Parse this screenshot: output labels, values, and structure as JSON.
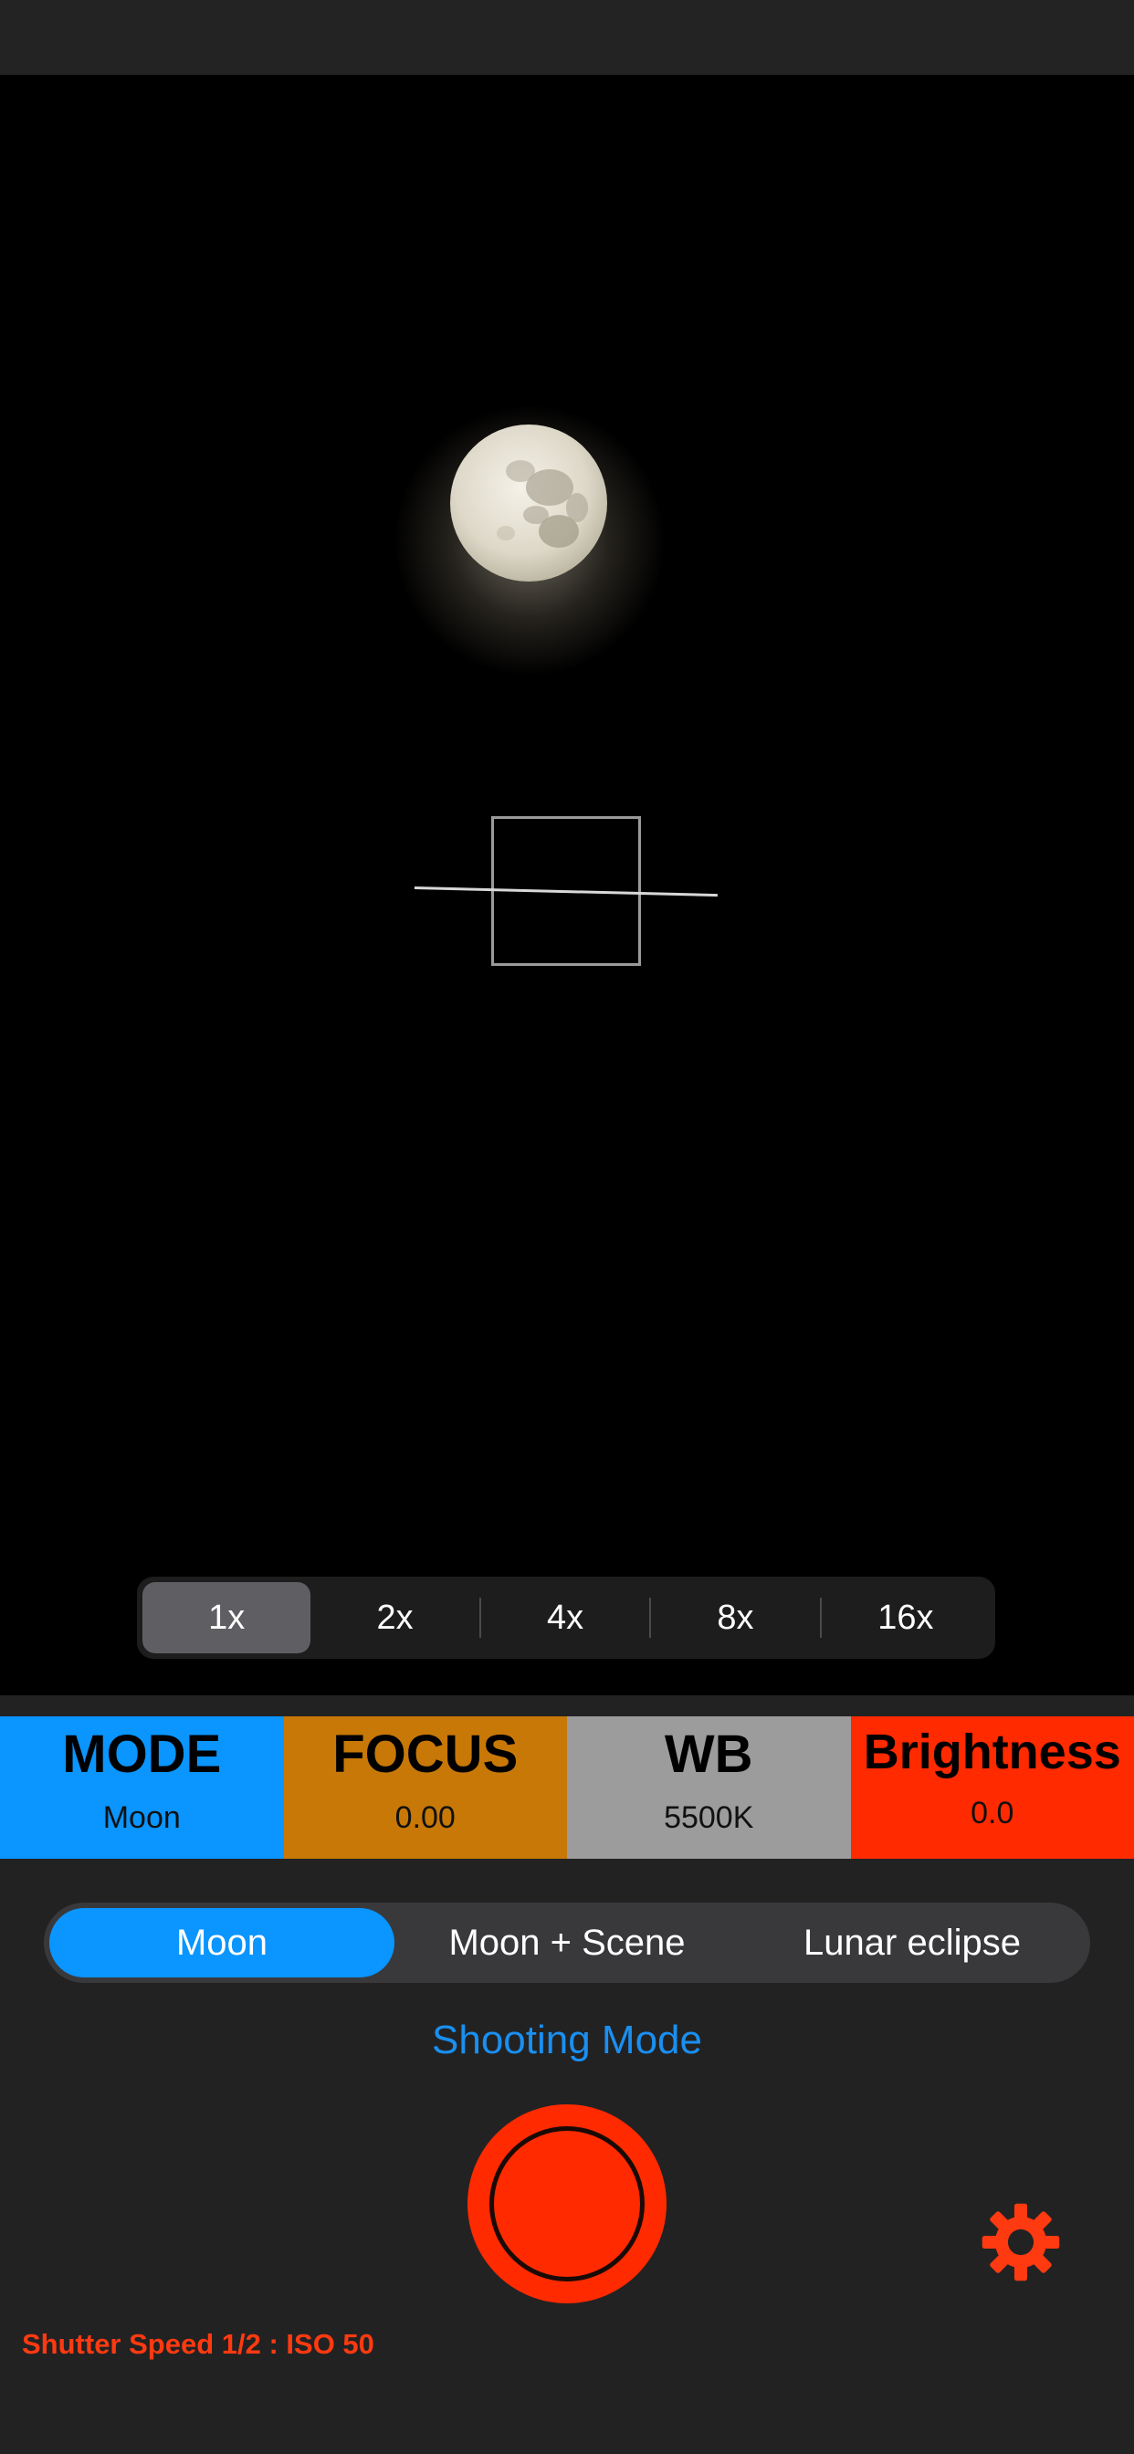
{
  "zoom": {
    "options": [
      "1x",
      "2x",
      "4x",
      "8x",
      "16x"
    ],
    "selected": "1x"
  },
  "settings": {
    "mode": {
      "title": "MODE",
      "value": "Moon",
      "color": "#0a95ff"
    },
    "focus": {
      "title": "FOCUS",
      "value": "0.00",
      "color": "#c77806"
    },
    "wb": {
      "title": "WB",
      "value": "5500K",
      "color": "#9c9c9c"
    },
    "brightness": {
      "title": "Brightness",
      "value": "0.0",
      "color": "#ff2a00"
    }
  },
  "shooting_modes": {
    "items": [
      "Moon",
      "Moon + Scene",
      "Lunar eclipse"
    ],
    "selected": "Moon",
    "label": "Shooting Mode"
  },
  "shutter": {
    "color": "#ff2a00"
  },
  "settings_icon": {
    "icon": "gear-icon",
    "color": "#ff3a10"
  },
  "status": {
    "text": "Shutter Speed 1/2 : ISO 50"
  }
}
